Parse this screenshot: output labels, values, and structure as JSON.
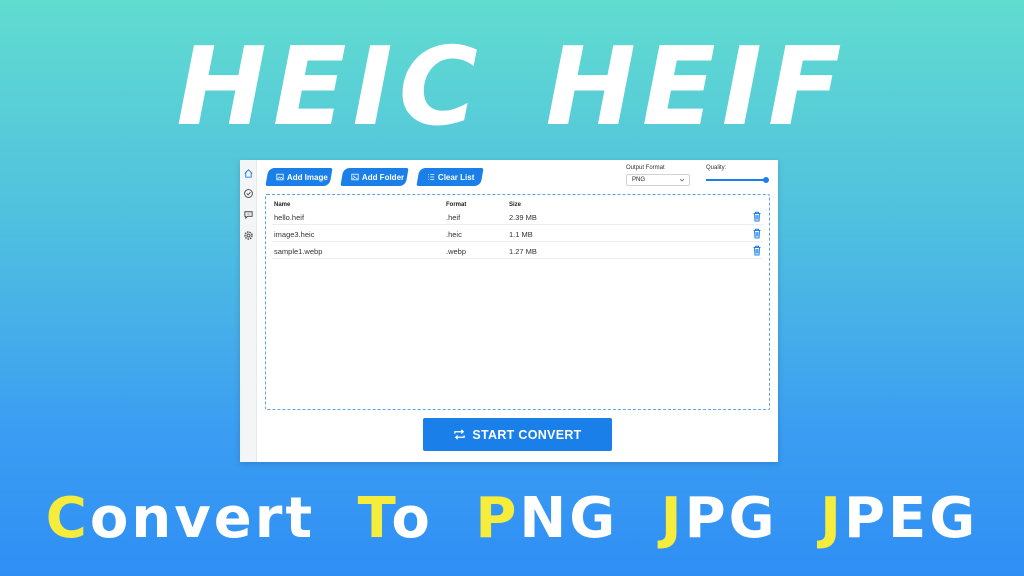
{
  "banner": {
    "headline": "HEIC HEIF",
    "tagline": [
      {
        "first": "C",
        "rest": "onvert"
      },
      {
        "first": "T",
        "rest": "o"
      },
      {
        "first": "P",
        "rest": "NG"
      },
      {
        "first": "J",
        "rest": "PG"
      },
      {
        "first": "J",
        "rest": "PEG"
      }
    ]
  },
  "colors": {
    "accent": "#1a7fe8",
    "tagline_highlight": "#f6ec3c",
    "bg_top": "#61dccf",
    "bg_bottom": "#2f8ff5"
  },
  "sidebar": {
    "icons": [
      "home-icon",
      "check-circle-icon",
      "chat-icon",
      "settings-icon"
    ]
  },
  "toolbar": {
    "add_image": "Add Image",
    "add_folder": "Add Folder",
    "clear_list": "Clear List",
    "output_format_label": "Output Format",
    "output_format_value": "PNG",
    "quality_label": "Quality:",
    "quality_value": 1.0
  },
  "table": {
    "headers": {
      "name": "Name",
      "format": "Format",
      "size": "Size"
    },
    "rows": [
      {
        "name": "hello.heif",
        "format": ".heif",
        "size": "2.39 MB"
      },
      {
        "name": "image3.heic",
        "format": ".heic",
        "size": "1.1 MB"
      },
      {
        "name": "sample1.webp",
        "format": ".webp",
        "size": "1.27 MB"
      }
    ]
  },
  "start_button": "START CONVERT"
}
